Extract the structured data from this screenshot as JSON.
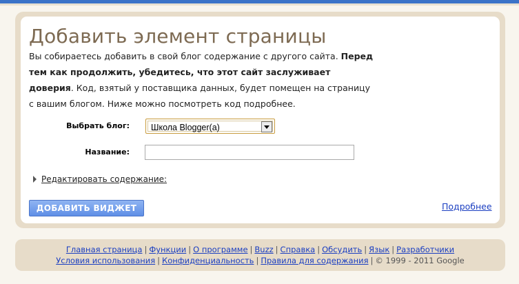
{
  "page": {
    "title": "Добавить элемент страницы",
    "intro_normal_1": "Вы собираетесь добавить в свой блог содержание с другого сайта. ",
    "intro_bold": "Перед тем как продолжить, убедитесь, что этот сайт заслуживает доверия",
    "intro_normal_2": ". Код, взятый у поставщика данных, будет помещен на страницу с вашим блогом. Ниже можно посмотреть код подробнее."
  },
  "form": {
    "blog_label": "Выбрать блог:",
    "blog_selected": "Школа Blogger(а)",
    "name_label": "Название:",
    "name_value": "",
    "edit_content_label": "Редактировать содержание:"
  },
  "actions": {
    "add_widget_label": "ДОБАВИТЬ ВИДЖЕТ",
    "more_link": "Подробнее"
  },
  "footer": {
    "row1": [
      "Главная страница",
      "Функции",
      "О программе",
      "Buzz",
      "Справка",
      "Обсудить",
      "Язык",
      "Разработчики"
    ],
    "row2": [
      "Условия использования",
      "Конфиденциальность",
      "Правила для содержания"
    ],
    "copyright": "© 1999 - 2011 Google"
  },
  "colors": {
    "accent_blue": "#3b73c8",
    "title_brown": "#7d6a52",
    "frame_beige": "#e7dcc9",
    "link_blue": "#1a3ec1"
  }
}
